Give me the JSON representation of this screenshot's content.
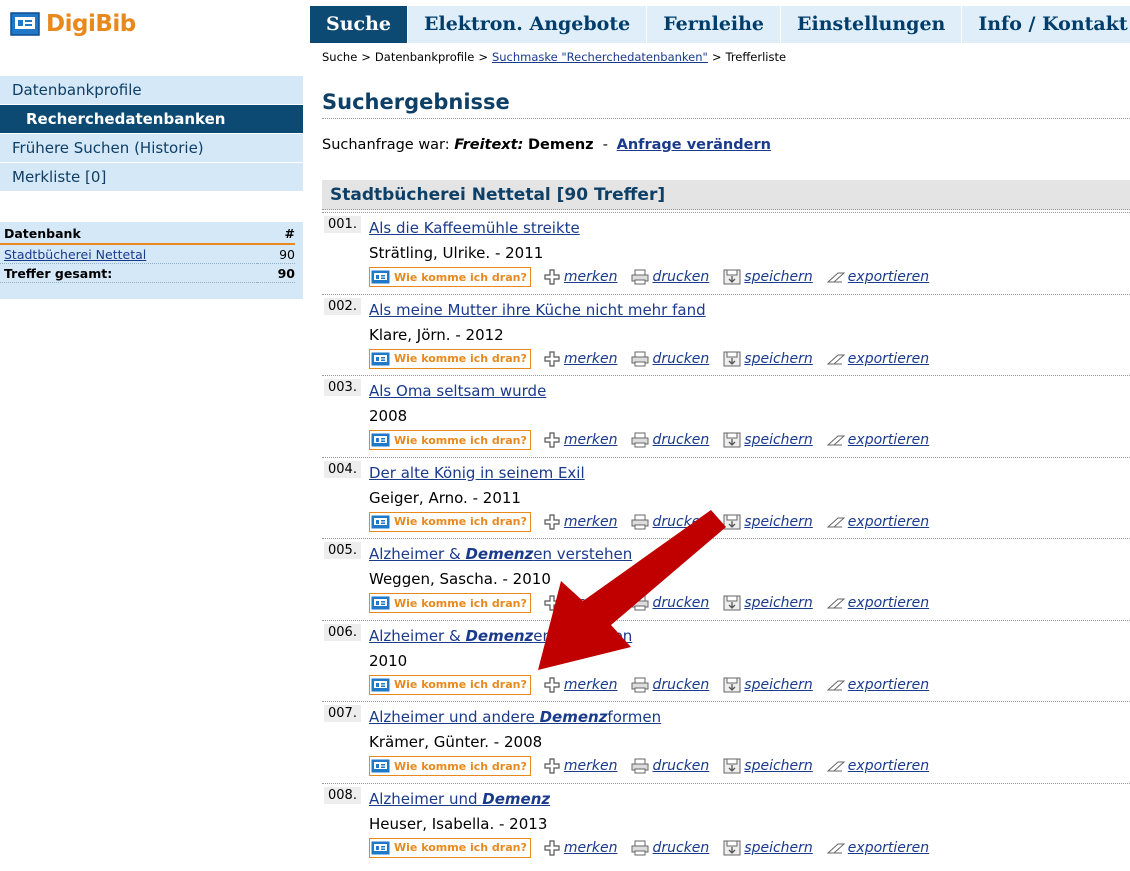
{
  "app": {
    "name": "DigiBib"
  },
  "topnav": [
    "Suche",
    "Elektron. Angebote",
    "Fernleihe",
    "Einstellungen",
    "Info / Kontakt"
  ],
  "breadcrumb": {
    "parts": [
      "Suche",
      "Datenbankprofile",
      "Suchmaske \"Recherchedatenbanken\"",
      "Trefferliste"
    ],
    "separator": ">"
  },
  "sidebar": {
    "items": [
      "Datenbankprofile",
      "Recherchedatenbanken",
      "Frühere Suchen (Historie)",
      "Merkliste [0]"
    ]
  },
  "db_table": {
    "col_db": "Datenbank",
    "col_count": "#",
    "row_name": "Stadtbücherei Nettetal",
    "row_count": "90",
    "total_label": "Treffer gesamt:",
    "total_count": "90"
  },
  "main": {
    "title": "Suchergebnisse",
    "query_prefix": "Suchanfrage war:",
    "query_field": "Freitext:",
    "query_term": "Demenz",
    "query_dash": "-",
    "change_link": "Anfrage verändern",
    "result_heading": "Stadtbücherei Nettetal [90 Treffer]"
  },
  "actions": {
    "wie": "Wie komme ich dran?",
    "merken": "merken",
    "drucken": "drucken",
    "speichern": "speichern",
    "exportieren": "exportieren"
  },
  "results": [
    {
      "num": "001.",
      "title_a": "Als die Kaffeemühle streikte",
      "title_hl": "",
      "title_b": "",
      "author": "Strätling, Ulrike. - 2011"
    },
    {
      "num": "002.",
      "title_a": "Als meine Mutter ihre Küche nicht mehr fand",
      "title_hl": "",
      "title_b": "",
      "author": "Klare, Jörn. - 2012"
    },
    {
      "num": "003.",
      "title_a": "Als Oma seltsam wurde",
      "title_hl": "",
      "title_b": "",
      "author": "2008"
    },
    {
      "num": "004.",
      "title_a": "Der alte König in seinem Exil",
      "title_hl": "",
      "title_b": "",
      "author": "Geiger, Arno. - 2011"
    },
    {
      "num": "005.",
      "title_a": "Alzheimer & ",
      "title_hl": "Demenz",
      "title_b": "en verstehen",
      "author": "Weggen, Sascha. - 2010"
    },
    {
      "num": "006.",
      "title_a": "Alzheimer & ",
      "title_hl": "Demenz",
      "title_b": "en verstehen",
      "author": "2010"
    },
    {
      "num": "007.",
      "title_a": "Alzheimer und andere ",
      "title_hl": "Demenz",
      "title_b": "formen",
      "author": "Krämer, Günter. - 2008"
    },
    {
      "num": "008.",
      "title_a": "Alzheimer und ",
      "title_hl": "Demenz",
      "title_b": "",
      "author": "Heuser, Isabella. - 2013"
    }
  ],
  "colors": {
    "brand_orange": "#e8891e",
    "nav_dark": "#0c4a74",
    "nav_light": "#dfeef8",
    "arrow": "#c00000"
  }
}
